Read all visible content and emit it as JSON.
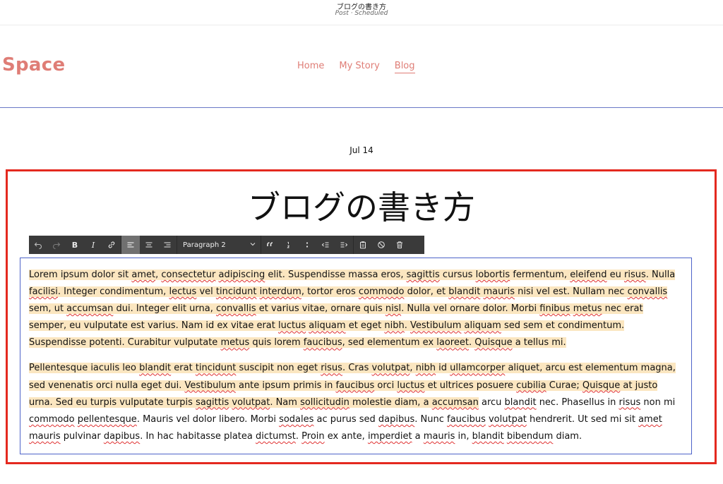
{
  "topbar": {
    "title": "ブログの書き方",
    "status": "Post · Scheduled"
  },
  "header": {
    "logo": "Space",
    "nav": [
      {
        "label": "Home",
        "active": false
      },
      {
        "label": "My Story",
        "active": false
      },
      {
        "label": "Blog",
        "active": true
      }
    ]
  },
  "post": {
    "date": "Jul 14",
    "title": "ブログの書き方"
  },
  "toolbar": {
    "buttons": [
      "undo-icon",
      "redo-icon",
      "bold-icon",
      "italic-icon",
      "link-icon",
      "align-left-icon",
      "align-center-icon",
      "align-right-icon",
      "quote-icon",
      "ordered-list-icon",
      "unordered-list-icon",
      "outdent-icon",
      "indent-icon",
      "clipboard-icon",
      "clear-format-icon",
      "trash-icon"
    ],
    "bold_label": "B",
    "italic_label": "I",
    "block_format": "Paragraph 2"
  },
  "colors": {
    "brand": "#df7d76",
    "highlight": "#fbe6c0",
    "frame": "#e4291f",
    "editor_border": "#4d63c9",
    "toolbar_bg": "#3a3a3a"
  },
  "body": {
    "p1": "Lorem ipsum dolor sit amet, consectetur adipiscing elit. Suspendisse massa eros, sagittis cursus lobortis fermentum, eleifend eu risus. Nulla facilisi. Integer condimentum, lectus vel tincidunt interdum, tortor eros commodo dolor, et blandit mauris nisi vel est. Nullam nec convallis sem, ut accumsan dui. Integer elit urna, convallis et varius vitae, ornare quis nisl. Nulla vel ornare dolor. Morbi finibus metus nec erat semper, eu vulputate est varius. Nam id ex vitae erat luctus aliquam et eget nibh. Vestibulum aliquam sed sem et condimentum. Suspendisse potenti. Curabitur vulputate metus quis lorem faucibus, sed elementum ex laoreet. Quisque a tellus mi.",
    "p2_highlighted": "Pellentesque iaculis leo blandit erat tincidunt suscipit non eget risus. Cras volutpat, nibh id ullamcorper aliquet, arcu est elementum magna, sed venenatis orci nulla eget dui. Vestibulum ante ipsum primis in faucibus orci luctus et ultrices posuere cubilia Curae; Quisque at justo urna. Sed eu turpis vulputate turpis sagittis volutpat. Nam sollicitudin molestie diam, a accumsan",
    "p2_rest": " arcu blandit nec. Phasellus in risus non mi commodo pellentesque. Mauris vel dolor libero. Morbi sodales ac purus sed dapibus. Nunc faucibus volutpat hendrerit. Ut sed mi sit amet mauris pulvinar dapibus. In hac habitasse platea dictumst. Proin ex ante, imperdiet a mauris in, blandit bibendum diam."
  },
  "spellcheck_words": [
    "amet",
    "consectetur",
    "adipiscing",
    "sagittis",
    "lobortis",
    "eleifend",
    "risus",
    "facilisi",
    "lectus",
    "tincidunt",
    "interdum",
    "commodo",
    "blandit",
    "mauris",
    "convallis",
    "accumsan",
    "nisl",
    "finibus",
    "luctus",
    "aliquam",
    "nibh",
    "Vestibulum",
    "metus",
    "faucibus",
    "laoreet",
    "Quisque",
    "volutpat",
    "ullamcorper",
    "cubilia",
    "sollicitudin",
    "pellentesque",
    "sodales",
    "dapibus",
    "dictumst",
    "Proin",
    "imperdiet",
    "bibendum"
  ]
}
